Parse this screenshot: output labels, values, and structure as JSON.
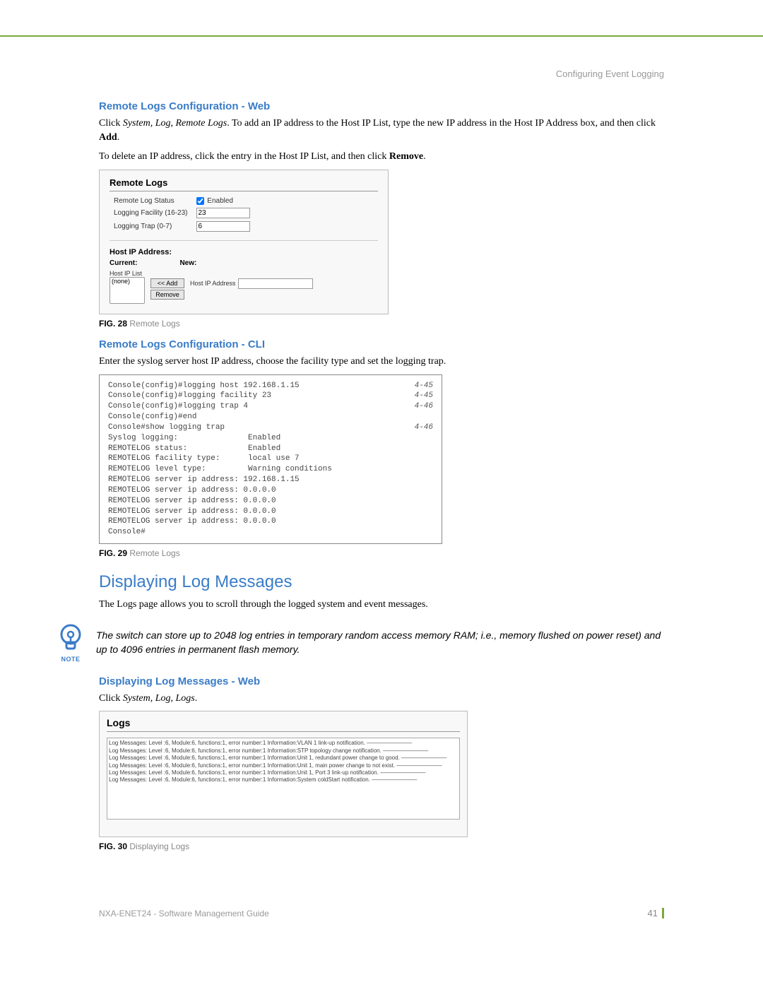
{
  "header": {
    "section": "Configuring Event Logging"
  },
  "section1": {
    "title": "Remote Logs Configuration - Web",
    "p1a": "Click ",
    "p1_nav": "System, Log, Remote Logs",
    "p1b": ". To add an IP address to the Host IP List, type the new IP address in the Host IP Address box, and then click ",
    "p1_bold": "Add",
    "p1c": ".",
    "p2a": "To delete an IP address, click the entry in the Host IP List, and then click ",
    "p2_bold": "Remove",
    "p2b": "."
  },
  "fig28": {
    "title": "Remote Logs",
    "row1_label": "Remote Log Status",
    "row1_cb": "Enabled",
    "row2_label": "Logging Facility (16-23)",
    "row2_val": "23",
    "row3_label": "Logging Trap (0-7)",
    "row3_val": "6",
    "host_label": "Host IP Address:",
    "current": "Current:",
    "new": "New:",
    "list_label": "Host IP List",
    "list_item": "(none)",
    "btn_add": "<< Add",
    "btn_remove": "Remove",
    "host_input_label": "Host IP Address",
    "caption_label": "FIG. 28",
    "caption_text": "Remote Logs"
  },
  "section2": {
    "title": "Remote Logs Configuration - CLI",
    "p1": "Enter the syslog server host IP address, choose the facility type and set the logging trap."
  },
  "cli": {
    "lines": [
      {
        "t": "Console(config)#logging host 192.168.1.15",
        "r": "4-45"
      },
      {
        "t": "Console(config)#logging facility 23",
        "r": "4-45"
      },
      {
        "t": "Console(config)#logging trap 4",
        "r": "4-46"
      },
      {
        "t": "Console(config)#end",
        "r": ""
      },
      {
        "t": "Console#show logging trap",
        "r": "4-46"
      },
      {
        "t": "Syslog logging:               Enabled",
        "r": ""
      },
      {
        "t": "REMOTELOG status:             Enabled",
        "r": ""
      },
      {
        "t": "REMOTELOG facility type:      local use 7",
        "r": ""
      },
      {
        "t": "REMOTELOG level type:         Warning conditions",
        "r": ""
      },
      {
        "t": "REMOTELOG server ip address: 192.168.1.15",
        "r": ""
      },
      {
        "t": "REMOTELOG server ip address: 0.0.0.0",
        "r": ""
      },
      {
        "t": "REMOTELOG server ip address: 0.0.0.0",
        "r": ""
      },
      {
        "t": "REMOTELOG server ip address: 0.0.0.0",
        "r": ""
      },
      {
        "t": "REMOTELOG server ip address: 0.0.0.0",
        "r": ""
      },
      {
        "t": "Console#",
        "r": ""
      }
    ],
    "caption_label": "FIG. 29",
    "caption_text": "Remote Logs"
  },
  "section3": {
    "title": "Displaying Log Messages",
    "p1": "The Logs page allows you to scroll through the logged system and event messages."
  },
  "note": {
    "label": "NOTE",
    "text": "The switch can store up to 2048 log entries in temporary random access memory RAM; i.e., memory flushed on power reset) and up to 4096 entries in permanent flash memory."
  },
  "section4": {
    "title": "Displaying Log Messages - Web",
    "p1a": "Click ",
    "p1_nav": "System, Log, Logs",
    "p1b": "."
  },
  "fig30": {
    "title": "Logs",
    "entries": [
      "Log Messages: Level :6, Module:6, functions:1, error number:1 Information:VLAN 1 link-up notification. ————————",
      "Log Messages: Level :6, Module:6, functions:1, error number:1 Information:STP topology change notification. ————————",
      "Log Messages: Level :6, Module:6, functions:1, error number:1 Information:Unit 1, redundant power change to good. ————————",
      "Log Messages: Level :6, Module:6, functions:1, error number:1 Information:Unit 1, main power change to not exist. ————————",
      "Log Messages: Level :6, Module:6, functions:1, error number:1 Information:Unit 1, Port 3 link-up notification. ————————",
      "Log Messages: Level :6, Module:6, functions:1, error number:1 Information:System coldStart notification. ————————"
    ],
    "caption_label": "FIG. 30",
    "caption_text": "Displaying Logs"
  },
  "footer": {
    "doc": "NXA-ENET24 - Software Management Guide",
    "page": "41"
  }
}
